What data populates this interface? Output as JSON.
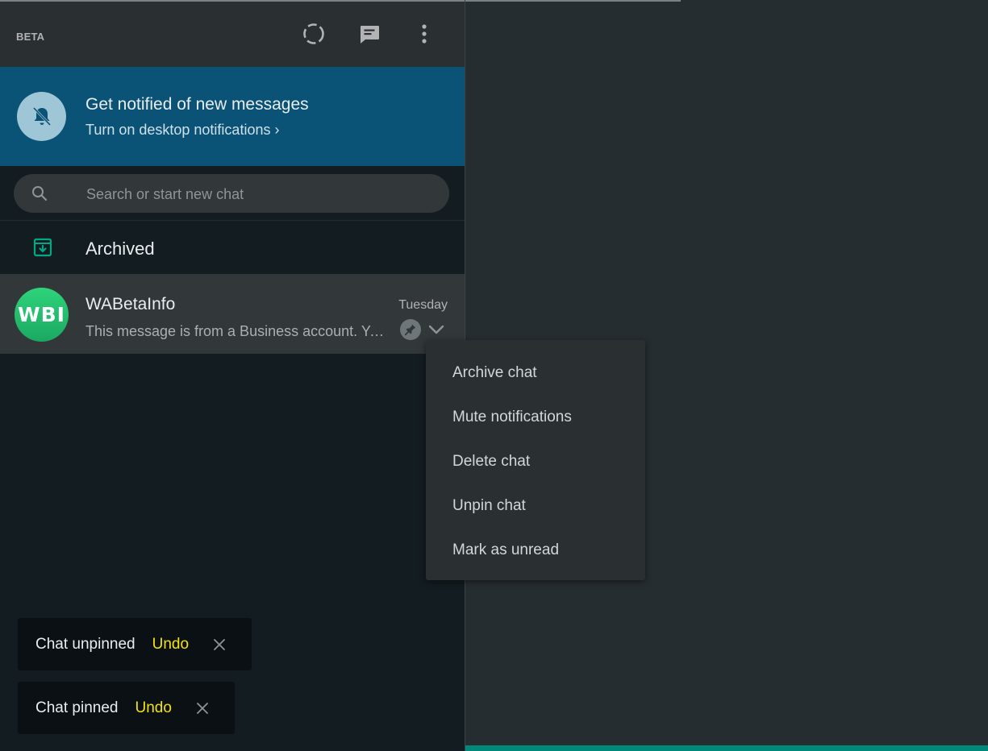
{
  "header": {
    "badge": "BETA",
    "icons": [
      "status-icon",
      "new-chat-icon",
      "menu-dots-icon"
    ]
  },
  "notification_banner": {
    "title": "Get notified of new messages",
    "subtitle": "Turn on desktop notifications ›",
    "icon": "bell-off-icon"
  },
  "search": {
    "placeholder": "Search or start new chat",
    "value": ""
  },
  "archived": {
    "label": "Archived",
    "icon": "archive-icon"
  },
  "chats": [
    {
      "avatar_text": "WBI",
      "name": "WABetaInfo",
      "time": "Tuesday",
      "preview": "This message is from a Business account. You can tap to learn more.",
      "pinned": true
    }
  ],
  "context_menu": {
    "items": [
      "Archive chat",
      "Mute notifications",
      "Delete chat",
      "Unpin chat",
      "Mark as unread"
    ]
  },
  "toasts": [
    {
      "text": "Chat unpinned",
      "action": "Undo"
    },
    {
      "text": "Chat pinned",
      "action": "Undo"
    }
  ],
  "colors": {
    "accent": "#00897b",
    "banner": "#0a5376",
    "undo": "#f2e30b",
    "avatar_green": "#25c36e"
  }
}
